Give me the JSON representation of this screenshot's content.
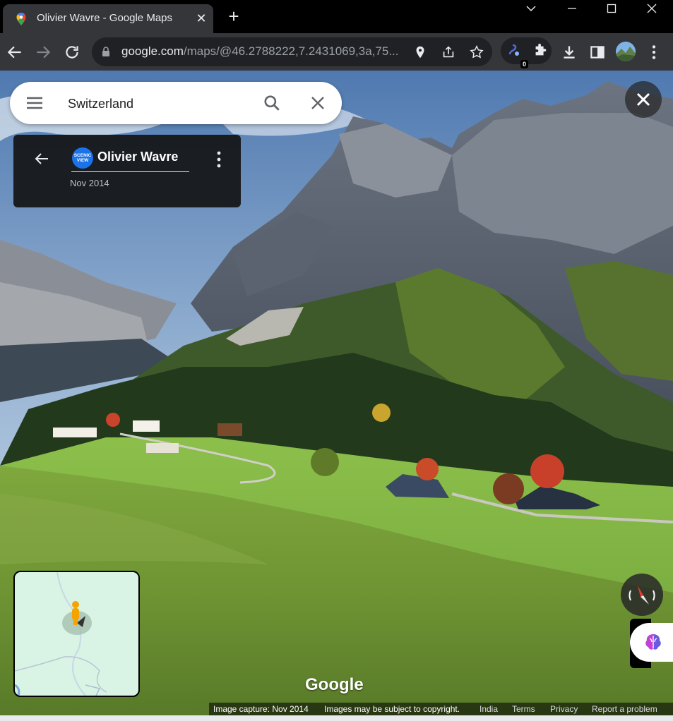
{
  "browser": {
    "tab": {
      "title": "Olivier Wavre - Google Maps"
    },
    "address": {
      "domain": "google.com",
      "path": "/maps/@46.2788222,7.2431069,3a,75..."
    },
    "extension_badge": "0"
  },
  "maps": {
    "search": {
      "value": "Switzerland"
    },
    "card": {
      "avatar_text_line1": "SCENIC",
      "avatar_text_line2": "VIEW",
      "title": "Olivier Wavre",
      "date": "Nov 2014"
    },
    "logo": "Google",
    "footer": {
      "capture": "Image capture: Nov 2014",
      "copyright": "Images may be subject to copyright.",
      "links": [
        "India",
        "Terms",
        "Privacy",
        "Report a problem"
      ]
    }
  },
  "colors": {
    "chrome_dark": "#35363a",
    "tabstrip": "#000000",
    "omnibox": "#202124",
    "minimap_bg": "#d9f3e4",
    "pegman": "#f4a400"
  },
  "icons": [
    "maps-favicon",
    "close-icon",
    "plus-icon",
    "chevron-down-icon",
    "minimize-icon",
    "maximize-icon",
    "back-arrow-icon",
    "forward-arrow-icon",
    "reload-icon",
    "lock-icon",
    "location-icon",
    "share-icon",
    "star-icon",
    "extension-icon",
    "puzzle-icon",
    "download-icon",
    "sidepanel-icon",
    "profile-avatar",
    "kebab-icon",
    "hamburger-menu-icon",
    "search-icon",
    "compass-icon",
    "pegman-icon"
  ]
}
